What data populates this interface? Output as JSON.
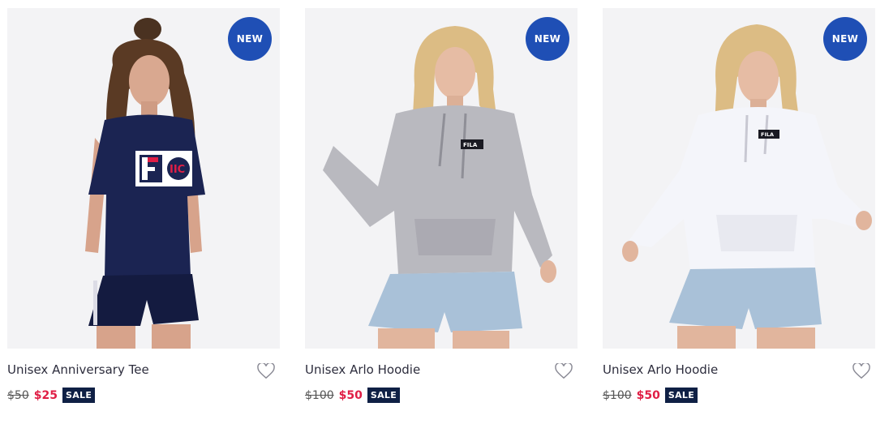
{
  "products": [
    {
      "badge": "NEW",
      "title": "Unisex Anniversary Tee",
      "old_price": "$50",
      "new_price": "$25",
      "sale_label": "SALE",
      "colors": {
        "garment": "#1b2452",
        "accent": "#e01e45"
      }
    },
    {
      "badge": "NEW",
      "title": "Unisex Arlo Hoodie",
      "old_price": "$100",
      "new_price": "$50",
      "sale_label": "SALE",
      "colors": {
        "garment": "#b9b9bf"
      }
    },
    {
      "badge": "NEW",
      "title": "Unisex Arlo Hoodie",
      "old_price": "$100",
      "new_price": "$50",
      "sale_label": "SALE",
      "colors": {
        "garment": "#f4f5fa"
      }
    }
  ],
  "theme": {
    "badge_blue": "#1f4fb5",
    "sale_navy": "#0f2045",
    "price_red": "#e01e45"
  }
}
